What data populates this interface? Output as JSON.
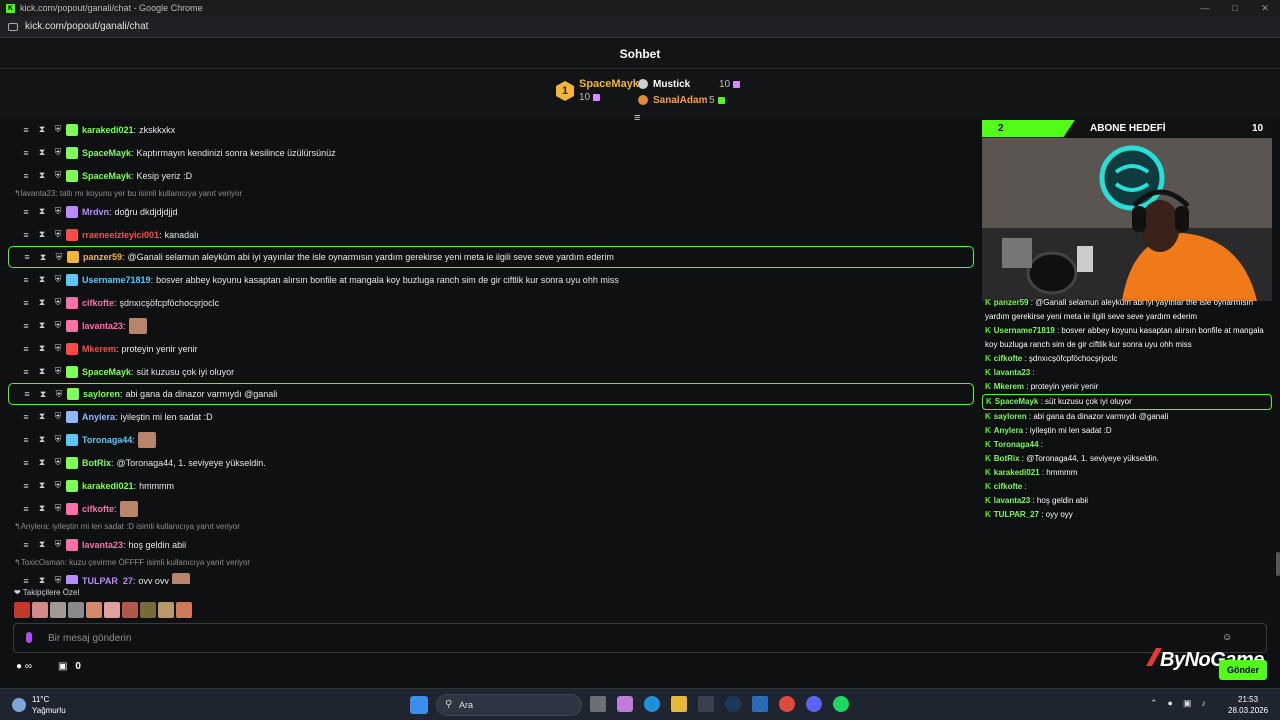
{
  "browser": {
    "window_title": "kick.com/popout/ganali/chat - Google Chrome",
    "url": "kick.com/popout/ganali/chat"
  },
  "chat": {
    "title": "Sohbet",
    "input_placeholder": "Bir mesaj gönderin",
    "followers_label": "Takipçilere Özel",
    "send_label": "Gönder",
    "bottom_count": "0",
    "accent_color": "#53fc18"
  },
  "leaderboard": {
    "first": {
      "rank": "1",
      "name": "SpaceMayk",
      "count": "10"
    },
    "others": [
      {
        "name": "Mustick",
        "count": "10"
      },
      {
        "name": "SanalAdam",
        "count": "5"
      }
    ]
  },
  "messages": [
    {
      "user": "karakedi021",
      "text": "zkskkxkx",
      "color": "#7dff58"
    },
    {
      "user": "SpaceMayk",
      "text": "Kaptırmayın kendinizi sonra kesilince üzülürsünüz",
      "color": "#7dff58"
    },
    {
      "user": "SpaceMayk",
      "text": "Kesip yeriz :D",
      "color": "#7dff58"
    },
    {
      "reply": "lavanta23: tatlı mı koyunu yer bu isimli kullanıcıya yanıt veriyor"
    },
    {
      "user": "Mrdvn",
      "text": "doğru dkdjdjdjjd",
      "color": "#b98bff"
    },
    {
      "user": "rraeneeizleyici001",
      "text": "kanadalı",
      "color": "#ff4a4a"
    },
    {
      "user": "panzer59",
      "text": "@Ganali selamun aleyküm abi iyi yayınlar the isle oynarmısın yardım gerekirse yeni meta ie ilgili seve seve yardım ederim",
      "color": "#f2b53a",
      "hl": true
    },
    {
      "user": "Username71819",
      "text": "bosver abbey koyunu kasaptan alırsın bonfile at mangala koy buzluga ranch sim de gir ciftlik kur sonra uyu ohh miss",
      "color": "#5ac8fa"
    },
    {
      "user": "cifkofte",
      "text": "şdnxıcşöfcpföchocşrjoclc",
      "color": "#ff6fa8"
    },
    {
      "user": "lavanta23",
      "text": "",
      "color": "#ff6fa8"
    },
    {
      "user": "Mkerem",
      "text": "proteyin yenir yenir",
      "color": "#ff4a4a"
    },
    {
      "user": "SpaceMayk",
      "text": "süt kuzusu çok iyi oluyor",
      "color": "#7dff58"
    },
    {
      "user": "sayloren",
      "text": "abi gana da dinazor varmıydı @ganali",
      "color": "#7dff58",
      "hl": true
    },
    {
      "user": "Anylera",
      "text": "iyileştin mi len sadat :D",
      "color": "#8fb8ff"
    },
    {
      "user": "Toronaga44",
      "text": "",
      "color": "#5ac8fa"
    },
    {
      "user": "BotRix",
      "text": "@Toronaga44, 1. seviyeye yükseldin.",
      "color": "#7dff58"
    },
    {
      "user": "karakedi021",
      "text": "hmmmm",
      "color": "#7dff58"
    },
    {
      "user": "cifkofte",
      "text": "",
      "color": "#ff6fa8"
    },
    {
      "reply": "Anylera: iyileştin mi len sadat :D isimli kullanıcıya yanıt veriyor"
    },
    {
      "user": "lavanta23",
      "text": "hoş geldin abii",
      "color": "#ff6fa8"
    },
    {
      "reply": "ToxicOsman: kuzu çevirme ÖFFFF isimli kullanıcıya yanıt veriyor"
    },
    {
      "user": "TULPAR_27",
      "text": "oyy oyy",
      "color": "#b98bff"
    }
  ],
  "overlay": {
    "goal_title": "ABONE HEDEFİ",
    "goal_current": "2",
    "goal_target": "10",
    "goal_progress": 0.2,
    "brand": "ByNoGame",
    "messages": [
      {
        "user": "panzer59",
        "text": "@Ganali selamun aleyküm abi iyi yayınlar the isle oynarmısın yardım gerekirse yeni meta ie ilgili seve seve yardım ederim"
      },
      {
        "user": "Username71819",
        "text": "bosver abbey koyunu kasaptan alırsın bonfile at mangala koy buzluga ranch sim de gir ciftlik kur sonra uyu ohh miss"
      },
      {
        "user": "cifkofte",
        "text": "şdnxıcşöfcpföchocşrjoclc"
      },
      {
        "user": "lavanta23",
        "text": ""
      },
      {
        "user": "Mkerem",
        "text": "proteyin yenir yenir"
      },
      {
        "user": "SpaceMayk",
        "text": "süt kuzusu çok iyi oluyor",
        "hl": true
      },
      {
        "user": "sayloren",
        "text": "abi gana da dinazor varmıydı @ganali"
      },
      {
        "user": "Anylera",
        "text": "iyileştin mi len sadat :D"
      },
      {
        "user": "Toronaga44",
        "text": ""
      },
      {
        "user": "BotRix",
        "text": "@Toronaga44, 1. seviyeye yükseldin."
      },
      {
        "user": "karakedi021",
        "text": "hmmmm"
      },
      {
        "user": "cifkofte",
        "text": ""
      },
      {
        "user": "lavanta23",
        "text": "hoş geldin abii"
      },
      {
        "user": "TULPAR_27",
        "text": "oyy oyy"
      }
    ]
  },
  "taskbar": {
    "temperature": "11°C",
    "weather": "Yağmurlu",
    "search_placeholder": "Ara",
    "time": "21:53",
    "date": "28.03.2026"
  }
}
